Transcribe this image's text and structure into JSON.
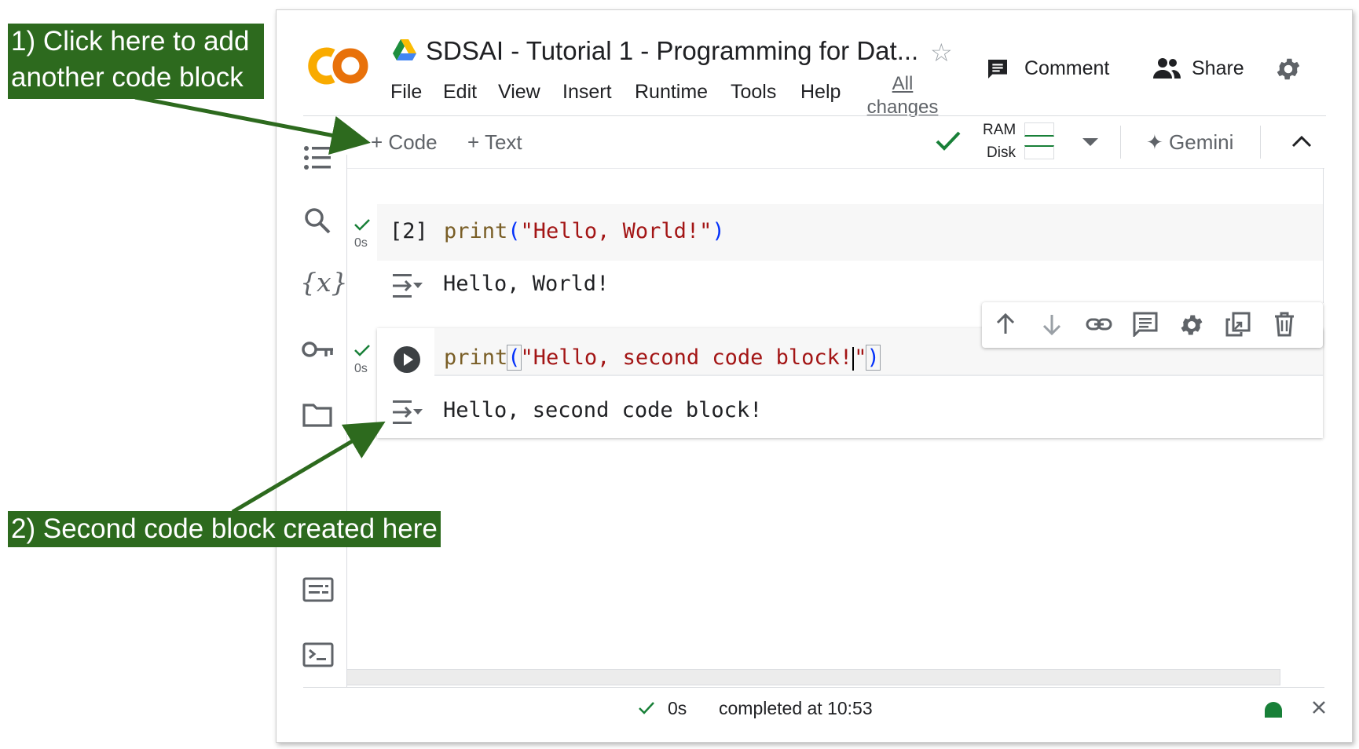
{
  "annotations": {
    "first": "1) Click here to add another code block",
    "first_line1": "1) Click here to add",
    "first_line2": "another code block",
    "second": "2) Second code block created here"
  },
  "header": {
    "notebook_title": "SDSAI - Tutorial 1 - Programming for Dat...",
    "menu": [
      "File",
      "Edit",
      "View",
      "Insert",
      "Runtime",
      "Tools",
      "Help"
    ],
    "all_changes": "All changes",
    "comment_label": "Comment",
    "share_label": "Share"
  },
  "toolbar": {
    "code_label": "Code",
    "text_label": "Text",
    "ram_label": "RAM",
    "disk_label": "Disk",
    "gemini_label": "Gemini"
  },
  "cells": [
    {
      "exec_count": "[2]",
      "duration": "0s",
      "code_fn": "print",
      "code_open": "(",
      "code_str": "\"Hello, World!\"",
      "code_close": ")",
      "output": "Hello, World!"
    },
    {
      "duration": "0s",
      "code_fn": "print",
      "code_open": "(",
      "code_str_a": "\"Hello, second code block!",
      "code_str_b": "\"",
      "code_close": ")",
      "output": "Hello, second code block!"
    }
  ],
  "status": {
    "duration": "0s",
    "completed": "completed at 10:53"
  },
  "colors": {
    "annotation_bg": "#2d6a1e",
    "check_green": "#188038",
    "connected_dot": "#188038"
  }
}
